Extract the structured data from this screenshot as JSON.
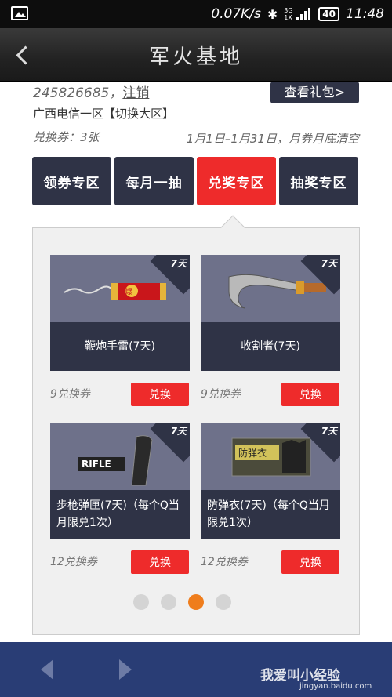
{
  "status_bar": {
    "net_speed": "0.07K/s",
    "signal_top": "3G",
    "signal_bottom": "1X",
    "battery": "40",
    "time": "11:48"
  },
  "header": {
    "title": "军火基地"
  },
  "account": {
    "qq": "245826685，",
    "logout": "注销",
    "gift_button": "查看礼包>",
    "region": "广西电信一区",
    "switch_region": "【切换大区】",
    "vouchers": "兑换券：3张",
    "date_note": "1月1日–1月31日，月券月底清空"
  },
  "tabs": [
    {
      "label": "领券专区",
      "active": false
    },
    {
      "label": "每月一抽",
      "active": false
    },
    {
      "label": "兑奖专区",
      "active": true
    },
    {
      "label": "抽奖专区",
      "active": false
    }
  ],
  "items": [
    {
      "name": "鞭炮手雷(7天)",
      "badge": "7天",
      "price": "9兑换券",
      "button": "兑换",
      "icon": "firecracker-grenade-icon"
    },
    {
      "name": "收割者(7天)",
      "badge": "7天",
      "price": "9兑换券",
      "button": "兑换",
      "icon": "reaper-blade-icon"
    },
    {
      "name": "步枪弹匣(7天)（每个Q当月限兑1次）",
      "badge": "7天",
      "price": "12兑换券",
      "button": "兑换",
      "icon": "rifle-magazine-icon",
      "label_on_image": "RIFLE"
    },
    {
      "name": "防弹衣(7天)（每个Q当月限兑1次）",
      "badge": "7天",
      "price": "12兑换券",
      "button": "兑换",
      "icon": "bulletproof-vest-icon",
      "label_on_image": "防弹衣"
    }
  ],
  "pagination": {
    "count": 4,
    "active": 3
  },
  "watermark": {
    "text": "我爱叫小经验",
    "url": "jingyan.baidu.com"
  },
  "colors": {
    "accent_red": "#ee2b2b",
    "navy": "#2f3346",
    "dot_active": "#ef7d1c",
    "bottom_bar": "#293d75"
  }
}
